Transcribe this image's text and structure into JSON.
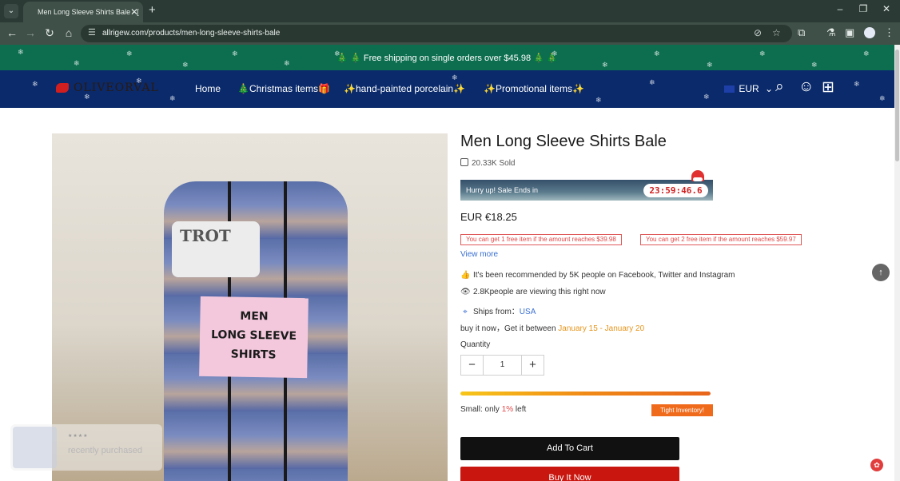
{
  "browser": {
    "tab_title": "Men Long Sleeve Shirts Bale - [",
    "url": "allrigew.com/products/men-long-sleeve-shirts-bale",
    "icons": {
      "tab_menu": "chevron-down-icon",
      "tab_close": "close-icon",
      "new_tab": "plus-icon",
      "back": "back-arrow-icon",
      "forward": "forward-arrow-icon",
      "reload": "reload-icon",
      "home": "home-icon",
      "site_info": "tune-icon",
      "eye_off": "eye-off-icon",
      "bookmark": "star-icon",
      "extensions": "puzzle-icon",
      "profile": "avatar-icon",
      "menu": "more-vertical-icon"
    }
  },
  "site": {
    "announcement": "🎄 🎄 Free shipping on single orders over $45.98 🎄 🎄",
    "logo_text": "OLIVEORVAL",
    "nav": [
      "Home",
      "🎄Christmas items🎁",
      "✨hand-painted porcelain✨",
      "✨Promotional items✨"
    ],
    "currency": "EUR",
    "header_icons": [
      "search-icon",
      "account-icon",
      "gift-icon"
    ],
    "colors": {
      "announce_bg": "#0d6e4f",
      "header_bg": "#0a2a6b"
    }
  },
  "product": {
    "title": "Men Long Sleeve Shirts Bale",
    "sold": "20.33K Sold",
    "sale_text": "Hurry up! Sale Ends in",
    "timer": "23:59:46.6",
    "price": "EUR €18.25",
    "promos": [
      "You can get 1 free item if the amount reaches $39.98",
      "You can get 2 free item if the amount reaches $59.97"
    ],
    "view_more": "View more",
    "recommended": "It's been recommended by 5K people on Facebook, Twitter and Instagram",
    "viewing": "2.8Kpeople are viewing this right now",
    "ships_from_label": "Ships from：",
    "ships_from_value": "USA",
    "delivery_prefix": "buy it now，Get it between",
    "delivery_start": "January 15",
    "delivery_sep": " - ",
    "delivery_end": "January 20",
    "quantity_label": "Quantity",
    "quantity_value": "1",
    "stock_prefix": "Small: only ",
    "stock_num": "1%",
    "stock_suffix": " left",
    "stock_level": 1,
    "tight_label": "Tight Inventory!",
    "add_to_cart": "Add To Cart",
    "buy_now": "Buy It Now",
    "photo_label_lines": [
      "MEN",
      "LONG SLEEVE",
      "SHIRTS"
    ],
    "photo_tag": "TROT"
  },
  "recent": {
    "text": "recently purchased",
    "stars": "★★★★"
  }
}
